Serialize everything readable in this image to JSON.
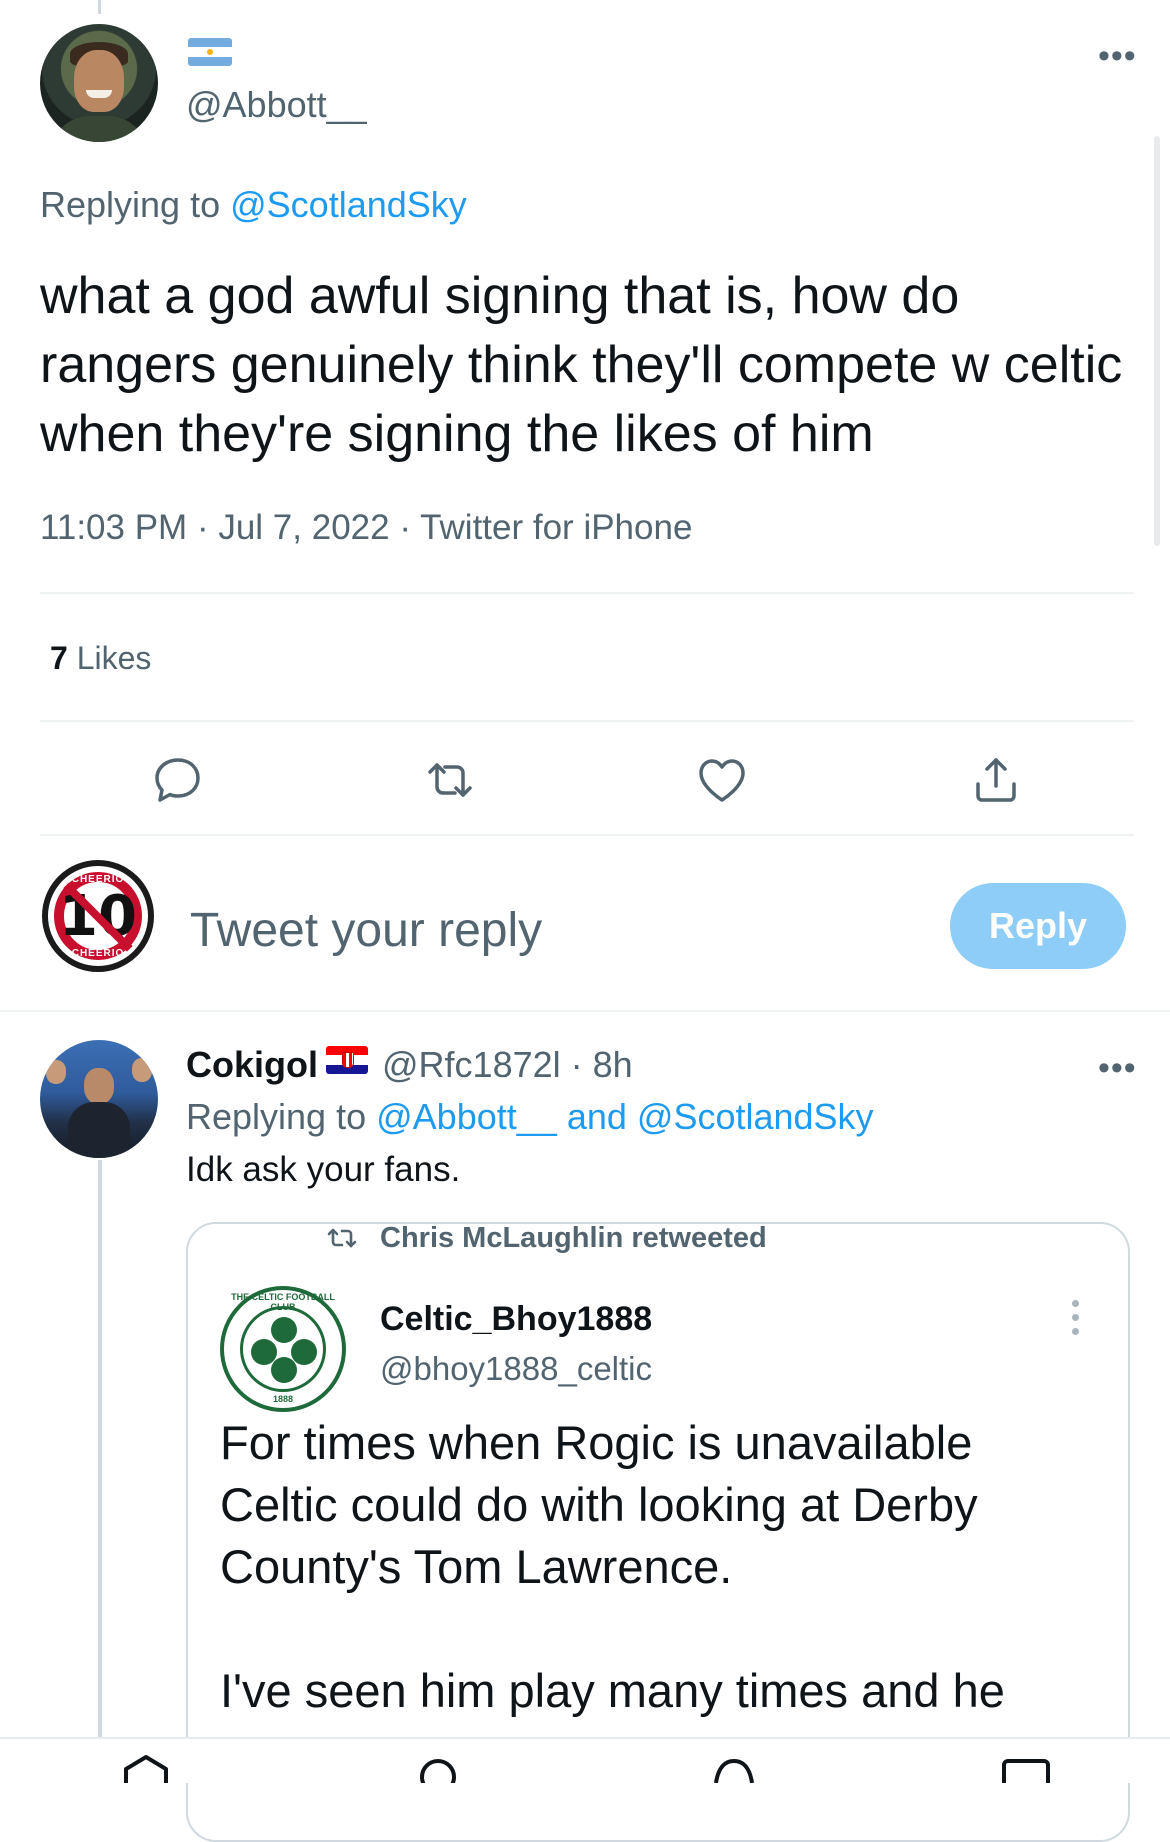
{
  "main_tweet": {
    "handle": "@Abbott__",
    "replying_prefix": "Replying to",
    "replying_to": "@ScotlandSky",
    "text": "what a god awful signing that is, how do rangers genuinely think they'll compete w celtic when they're signing the likes of him",
    "time": "11:03 PM",
    "date": "Jul 7, 2022",
    "source": "Twitter for iPhone",
    "likes_count": "7",
    "likes_label": "Likes",
    "more": "•••"
  },
  "composer": {
    "placeholder": "Tweet your reply",
    "button_label": "Reply"
  },
  "reply_tweet": {
    "name": "Cokigol",
    "handle": "@Rfc1872l",
    "age": "8h",
    "replying_prefix": "Replying to",
    "replying_to_1": "@Abbott__",
    "and_word": "and",
    "replying_to_2": "@ScotlandSky",
    "text": "Idk ask your fans.",
    "more": "•••"
  },
  "quoted": {
    "retweet_label": "Chris McLaughlin retweeted",
    "name": "Celtic_Bhoy1888",
    "handle": "@bhoy1888_celtic",
    "paragraph_1": "For times when Rogic is unavailable Celtic could do with looking at Derby County's Tom Lawrence.",
    "paragraph_2": "I've seen him play many times and he",
    "logo_ring_text": "THE CELTIC FOOTBALL CLUB",
    "logo_year": "1888"
  },
  "avatar_me": {
    "number": "10",
    "ring_text": "CHEERIO"
  },
  "icons": [
    "reply-icon",
    "retweet-icon",
    "like-icon",
    "share-icon",
    "home-icon",
    "search-icon",
    "spaces-icon",
    "notifications-icon",
    "messages-icon"
  ],
  "colors": {
    "accent": "#1d9bf0",
    "muted": "#536471",
    "reply_button": "#8ecdf7",
    "celtic_green": "#1e6a3a"
  }
}
